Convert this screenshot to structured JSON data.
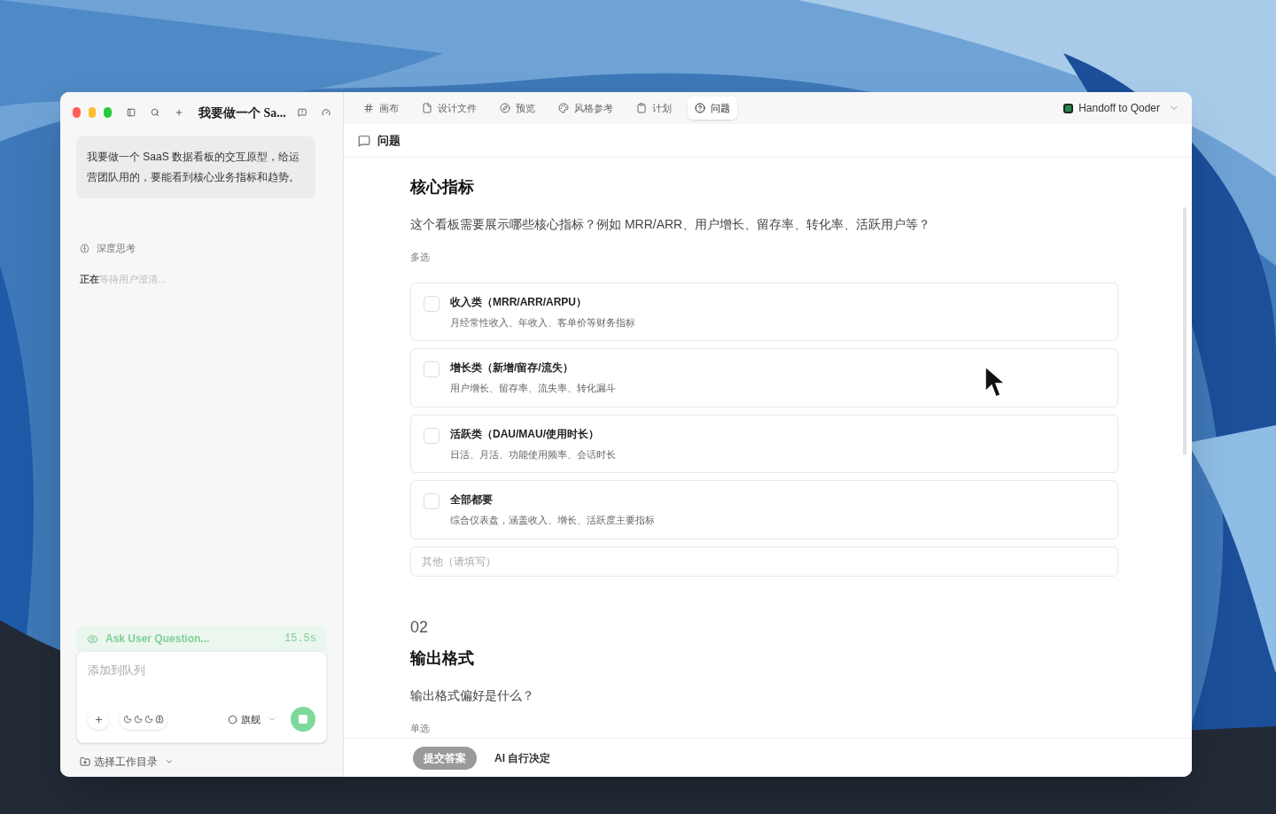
{
  "sidebar": {
    "title": "我要做一个 Sa...",
    "message": "我要做一个 SaaS 数据看板的交互原型，给运营团队用的，要能看到核心业务指标和趋势。",
    "thinking": {
      "label": "深度思考",
      "status": "**正在**等待用户澄清..."
    },
    "tool_call": {
      "name": "Ask User Question...",
      "time": "15.5s"
    },
    "composer": {
      "placeholder": "添加到队列",
      "model": "旗舰",
      "running": true
    },
    "workspace": "选择工作目录"
  },
  "tabs": [
    {
      "label": "画布",
      "selected": false
    },
    {
      "label": "设计文件",
      "selected": false
    },
    {
      "label": "预览",
      "selected": false
    },
    {
      "label": "风格参考",
      "selected": false
    },
    {
      "label": "计划",
      "selected": false
    },
    {
      "label": "问题",
      "selected": true
    }
  ],
  "handoff": "Handoff to Qoder",
  "panel_title": "问题",
  "questions": [
    {
      "title": "核心指标",
      "text": "这个看板需要展示哪些核心指标？例如 MRR/ARR、用户增长、留存率、转化率、活跃用户等？",
      "mode": "多选",
      "options": [
        {
          "label": "收入类（MRR/ARR/ARPU）",
          "description": "月经常性收入、年收入、客单价等财务指标",
          "checked": false
        },
        {
          "label": "增长类（新增/留存/流失）",
          "description": "用户增长、留存率、流失率、转化漏斗",
          "checked": false
        },
        {
          "label": "活跃类（DAU/MAU/使用时长）",
          "description": "日活、月活、功能使用频率、会话时长",
          "checked": false
        },
        {
          "label": "全部都要",
          "description": "综合仪表盘，涵盖收入、增长、活跃度主要指标",
          "checked": false
        }
      ],
      "other_placeholder": "其他（请填写）"
    },
    {
      "number": "02",
      "title": "输出格式",
      "text": "输出格式偏好是什么？",
      "mode": "单选"
    }
  ],
  "footer": {
    "submit": "提交答案",
    "auto": "AI 自行决定"
  }
}
